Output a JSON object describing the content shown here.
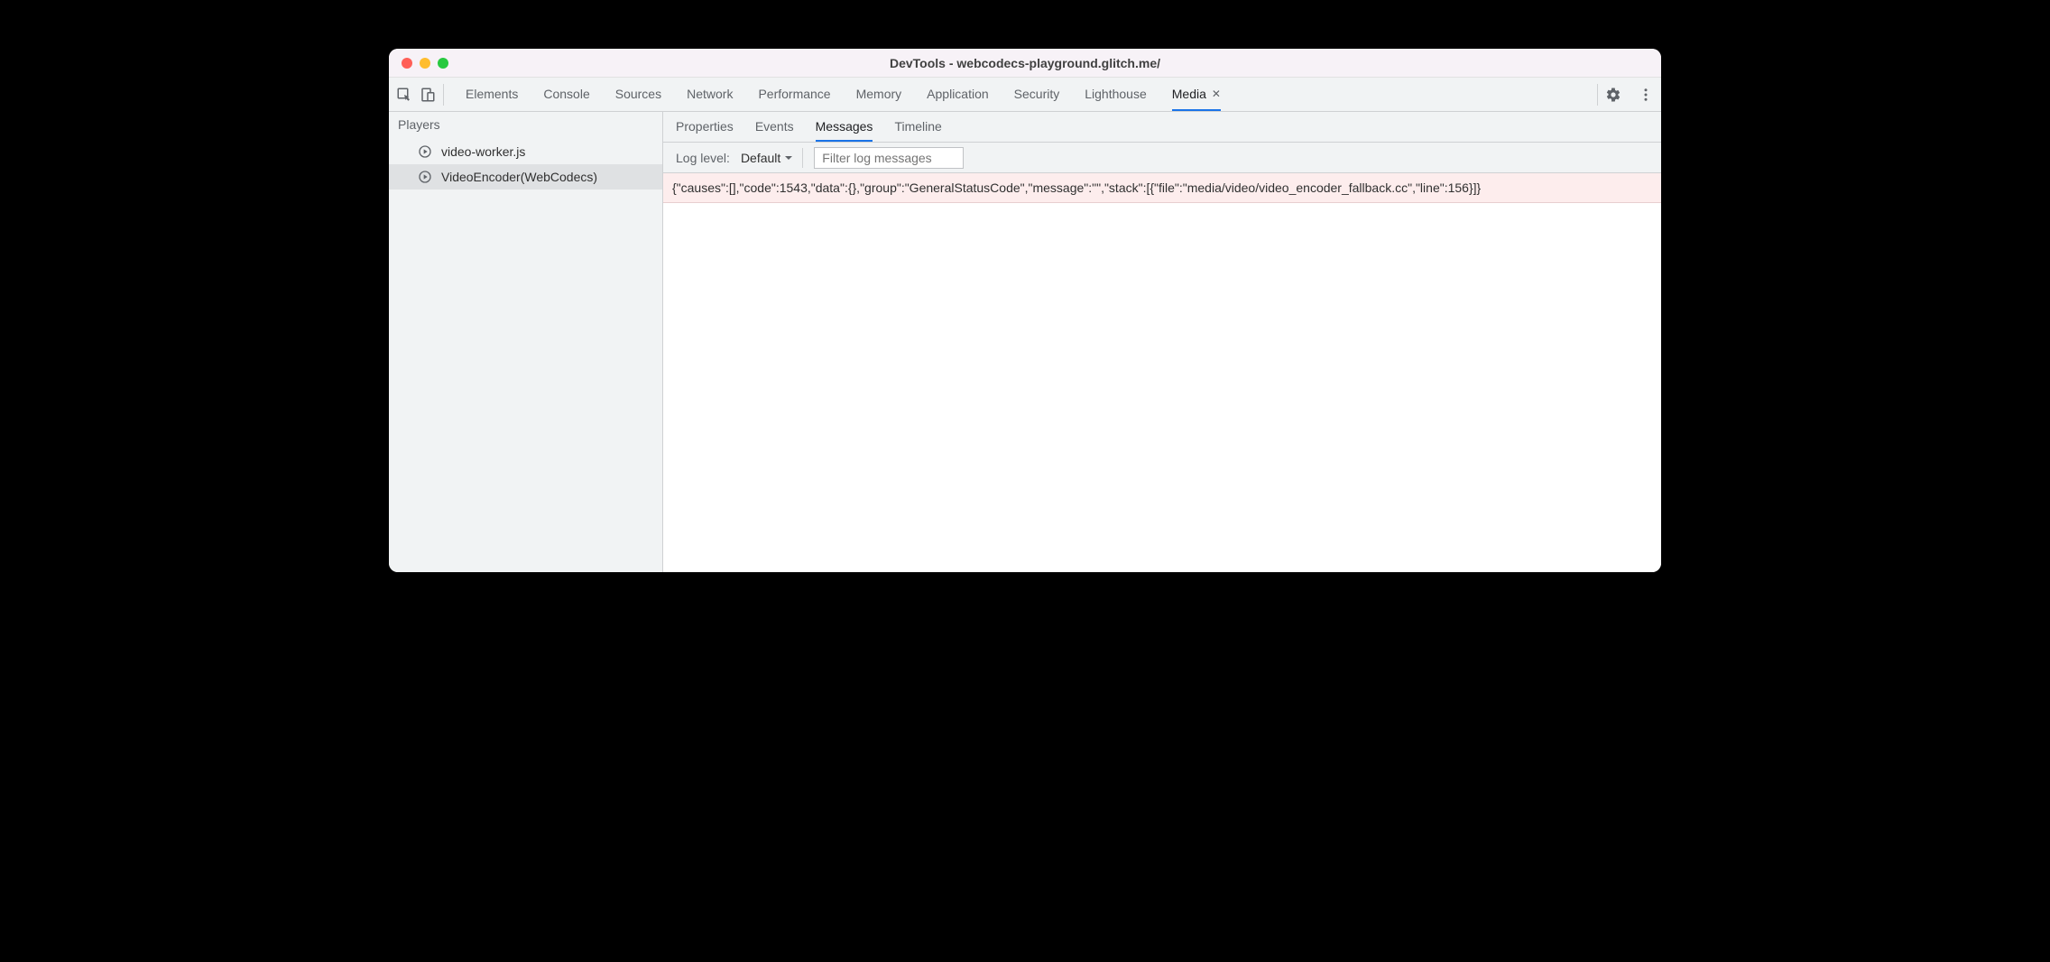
{
  "window": {
    "title": "DevTools - webcodecs-playground.glitch.me/"
  },
  "toolbar": {
    "tabs": [
      {
        "label": "Elements",
        "active": false,
        "closable": false
      },
      {
        "label": "Console",
        "active": false,
        "closable": false
      },
      {
        "label": "Sources",
        "active": false,
        "closable": false
      },
      {
        "label": "Network",
        "active": false,
        "closable": false
      },
      {
        "label": "Performance",
        "active": false,
        "closable": false
      },
      {
        "label": "Memory",
        "active": false,
        "closable": false
      },
      {
        "label": "Application",
        "active": false,
        "closable": false
      },
      {
        "label": "Security",
        "active": false,
        "closable": false
      },
      {
        "label": "Lighthouse",
        "active": false,
        "closable": false
      },
      {
        "label": "Media",
        "active": true,
        "closable": true
      }
    ]
  },
  "sidebar": {
    "title": "Players",
    "items": [
      {
        "label": "video-worker.js",
        "selected": false
      },
      {
        "label": "VideoEncoder(WebCodecs)",
        "selected": true
      }
    ]
  },
  "subtabs": [
    {
      "label": "Properties",
      "active": false
    },
    {
      "label": "Events",
      "active": false
    },
    {
      "label": "Messages",
      "active": true
    },
    {
      "label": "Timeline",
      "active": false
    }
  ],
  "filter": {
    "label": "Log level:",
    "selected": "Default",
    "placeholder": "Filter log messages"
  },
  "logs": [
    {
      "text": "{\"causes\":[],\"code\":1543,\"data\":{},\"group\":\"GeneralStatusCode\",\"message\":\"\",\"stack\":[{\"file\":\"media/video/video_encoder_fallback.cc\",\"line\":156}]}",
      "level": "error"
    }
  ]
}
